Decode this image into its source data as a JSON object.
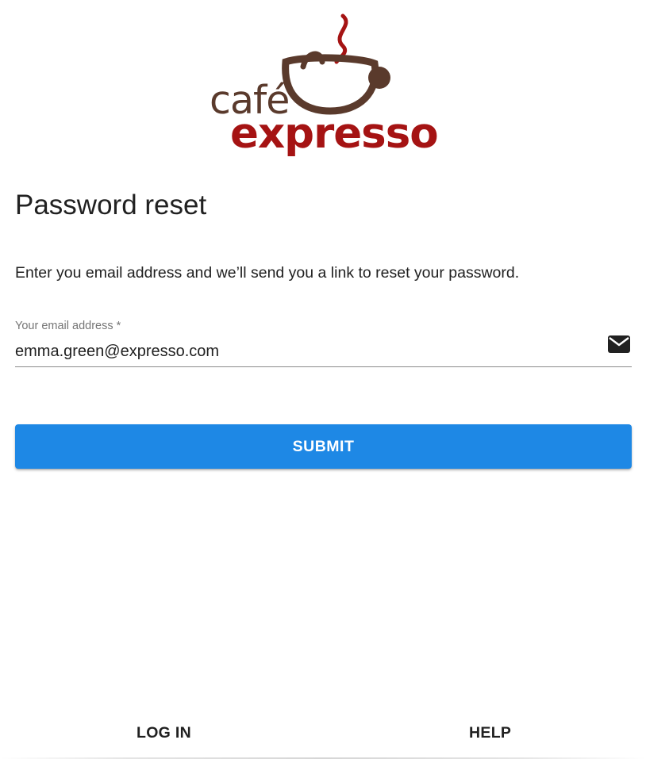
{
  "logo": {
    "line1": "café",
    "line2": "expresso",
    "brand_colors": {
      "brown": "#5a3a2c",
      "red": "#a51313"
    }
  },
  "page": {
    "title": "Password reset",
    "instructions": "Enter you email address and we’ll send you a link to reset your password."
  },
  "email_field": {
    "label": "Your email address *",
    "value": "emma.green@expresso.com",
    "icon": "mail-icon"
  },
  "submit": {
    "label": "SUBMIT",
    "color": "#1e88e5"
  },
  "bottom_nav": {
    "login_label": "LOG IN",
    "help_label": "HELP"
  }
}
